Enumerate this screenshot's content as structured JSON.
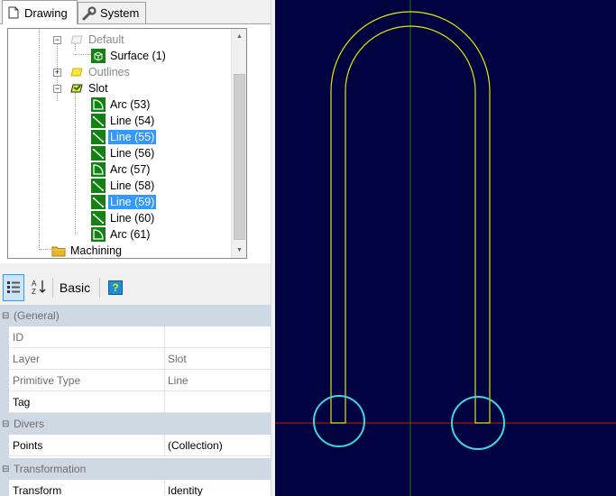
{
  "tabs": [
    {
      "label": "Drawing",
      "icon": "document-icon",
      "active": true
    },
    {
      "label": "System",
      "icon": "wrench-icon",
      "active": false
    }
  ],
  "tree": {
    "nodes": {
      "default": {
        "label": "Default",
        "icon": "layer-icon"
      },
      "surface": {
        "label": "Surface (1)",
        "icon": "surface-icon"
      },
      "outlines": {
        "label": "Outlines",
        "icon": "layer-icon"
      },
      "slot": {
        "label": "Slot",
        "icon": "active-layer-icon"
      },
      "arc53": {
        "label": "Arc (53)",
        "icon": "arc-icon"
      },
      "line54": {
        "label": "Line (54)",
        "icon": "line-icon"
      },
      "line55": {
        "label": "Line (55)",
        "icon": "line-icon",
        "selected": true
      },
      "line56": {
        "label": "Line (56)",
        "icon": "line-icon"
      },
      "arc57": {
        "label": "Arc (57)",
        "icon": "arc-icon"
      },
      "line58": {
        "label": "Line (58)",
        "icon": "line-icon"
      },
      "line59": {
        "label": "Line (59)",
        "icon": "line-icon",
        "selected": true
      },
      "line60": {
        "label": "Line (60)",
        "icon": "line-icon"
      },
      "arc61": {
        "label": "Arc (61)",
        "icon": "arc-icon"
      },
      "machining": {
        "label": "Machining",
        "icon": "folder-icon"
      }
    }
  },
  "toolbar": {
    "categorized_icon": "categorized-icon",
    "alphabetical_icon": "sort-az-icon",
    "basic_label": "Basic",
    "help_icon": "help-icon",
    "help_glyph": "?"
  },
  "properties": {
    "general": {
      "label": "(General)",
      "id": {
        "name": "ID",
        "value": ""
      },
      "layer": {
        "name": "Layer",
        "value": "Slot"
      },
      "primitive_type": {
        "name": "Primitive Type",
        "value": "Line"
      },
      "tag": {
        "name": "Tag",
        "value": ""
      }
    },
    "divers": {
      "label": "Divers",
      "points": {
        "name": "Points",
        "value": "(Collection)"
      }
    },
    "transformation": {
      "label": "Transformation",
      "transform": {
        "name": "Transform",
        "value": "Identity"
      }
    }
  },
  "colors": {
    "canvas_bg": "#010340",
    "slot_outline": "#e6e600",
    "circle": "#3fd6e0",
    "x_axis": "#c81414",
    "y_axis": "#127a12",
    "selection": "#3399ff"
  }
}
